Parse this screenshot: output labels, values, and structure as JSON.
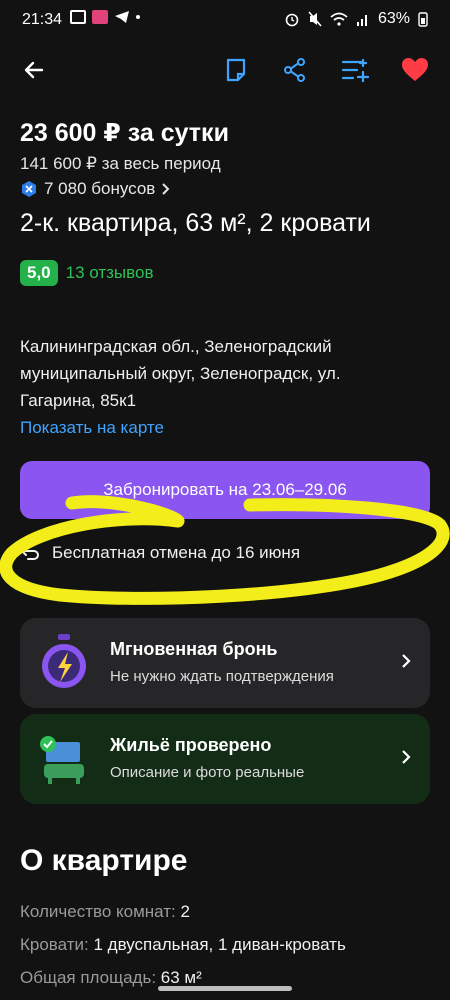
{
  "status": {
    "time": "21:34",
    "battery": "63%"
  },
  "toolbar": {
    "back_icon": "arrow-left-icon",
    "note_icon": "note-icon",
    "share_icon": "share-icon",
    "compare_icon": "list-add-icon",
    "favorite_icon": "heart-icon"
  },
  "listing": {
    "price": "23 600 ₽ за сутки",
    "total": "141 600 ₽ за весь период",
    "bonus": "7 080 бонусов",
    "title": "2-к. квартира, 63 м², 2 кровати",
    "rating": "5,0",
    "reviews": "13 отзывов",
    "address": "Калининградская обл., Зеленоградский муниципальный округ, Зеленоградск, ул. Гагарина, 85к1",
    "map_link": "Показать на карте"
  },
  "booking": {
    "button": "Забронировать на 23.06–29.06",
    "cancel": "Бесплатная отмена до 16 июня"
  },
  "cards": [
    {
      "title": "Мгновенная бронь",
      "subtitle": "Не нужно ждать подтверждения"
    },
    {
      "title": "Жильё проверено",
      "subtitle": "Описание и фото реальные"
    }
  ],
  "about": {
    "heading": "О квартире",
    "rows": [
      {
        "label": "Количество комнат:",
        "value": "2"
      },
      {
        "label": "Кровати:",
        "value": "1 двуспальная, 1 диван-кровать"
      },
      {
        "label": "Общая площадь:",
        "value": "63 м²"
      }
    ]
  },
  "colors": {
    "accent_purple": "#8a55f0",
    "link_blue": "#3ea4ff",
    "rating_green": "#25b14a",
    "favorite_red": "#ff3b45",
    "scribble_yellow": "#f3ee1a"
  }
}
